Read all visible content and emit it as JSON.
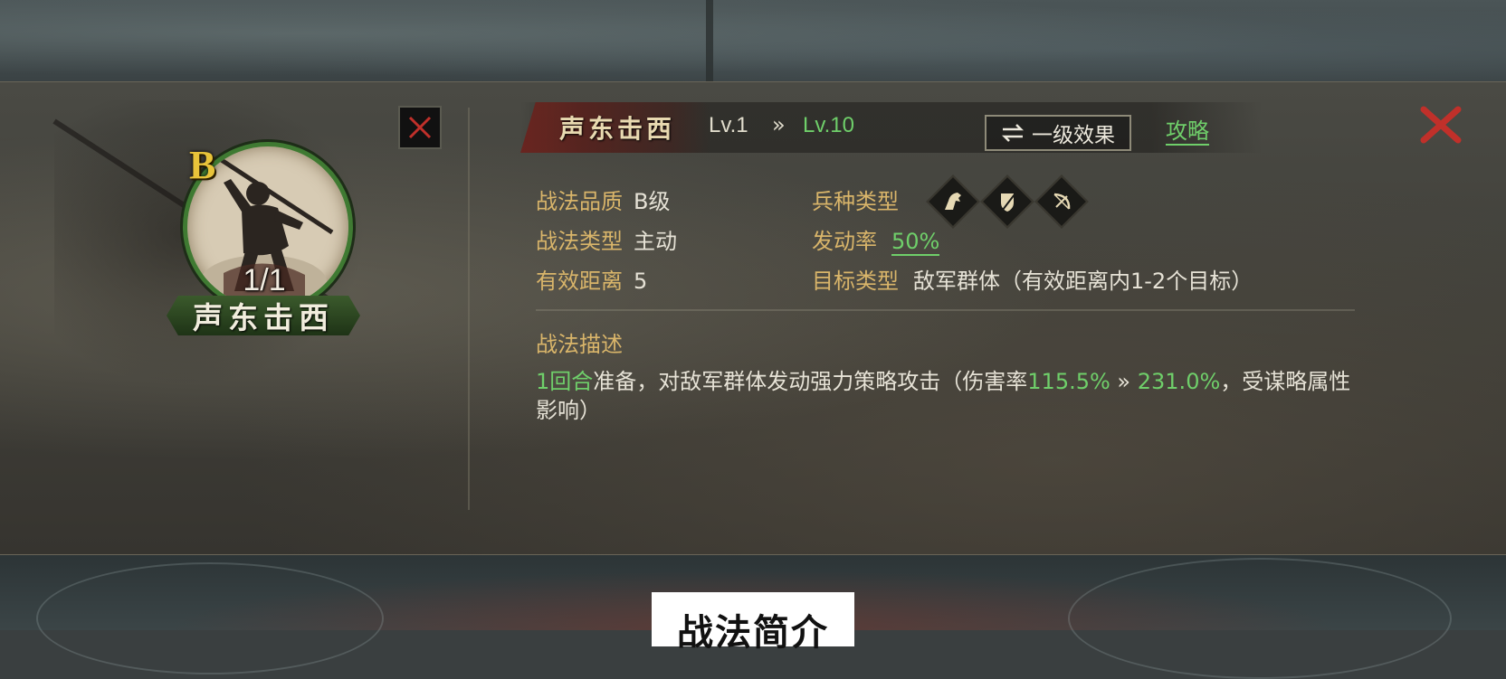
{
  "skill": {
    "name": "声东击西",
    "grade": "B",
    "count": "1/1",
    "level_from": "Lv.1",
    "level_arrow": "»",
    "level_to": "Lv.10"
  },
  "header": {
    "effect_button_icon": "swap-arrows-icon",
    "effect_button_label": "一级效果",
    "guide_link": "攻略"
  },
  "attributes": {
    "quality_key": "战法品质",
    "quality_value": "B级",
    "type_key": "战法类型",
    "type_value": "主动",
    "range_key": "有效距离",
    "range_value": "5",
    "troop_key": "兵种类型",
    "troop_icons": [
      "cavalry-icon",
      "shield-icon",
      "bow-icon"
    ],
    "rate_key": "发动率",
    "rate_value": "50%",
    "target_key": "目标类型",
    "target_value": "敌军群体（有效距离内1-2个目标）"
  },
  "description": {
    "title": "战法描述",
    "seg1": "1回合",
    "seg2": "准备，对敌军群体发动强力策略攻击（伤害率",
    "seg3": "115.5%",
    "seg4": " » ",
    "seg5": "231.0%",
    "seg6": "，受谋略属性影响）"
  },
  "caption": "战法简介",
  "colors": {
    "accent_green": "#6fcf6a",
    "label_gold": "#d9b56a",
    "grade_yellow": "#e8c43a",
    "close_red": "#c0302a"
  }
}
